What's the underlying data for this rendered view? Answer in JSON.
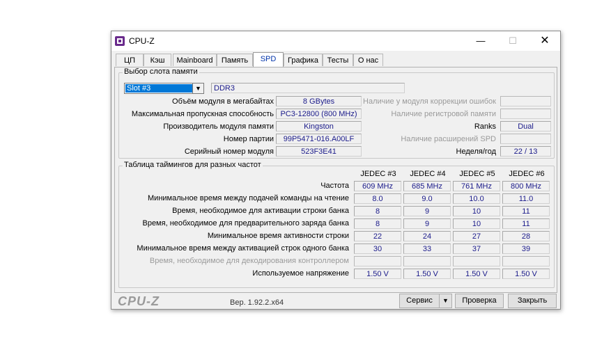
{
  "window": {
    "title": "CPU-Z",
    "minimize_glyph": "—",
    "maximize_glyph": "☐",
    "close_glyph": "✕"
  },
  "tabs": [
    {
      "label": "ЦП"
    },
    {
      "label": "Кэш"
    },
    {
      "label": "Mainboard"
    },
    {
      "label": "Память"
    },
    {
      "label": "SPD",
      "active": true
    },
    {
      "label": "Графика"
    },
    {
      "label": "Тесты"
    },
    {
      "label": "О нас"
    }
  ],
  "slot": {
    "legend": "Выбор слота памяти",
    "selected": "Slot #3",
    "type": "DDR3",
    "module_size_label": "Объём модуля в мегабайтах",
    "module_size": "8 GBytes",
    "max_bandwidth_label": "Максимальная пропускная способность",
    "max_bandwidth": "PC3-12800 (800 MHz)",
    "manufacturer_label": "Производитель модуля памяти",
    "manufacturer": "Kingston",
    "part_number_label": "Номер партии",
    "part_number": "99P5471-016.A00LF",
    "serial_label": "Серийный номер модуля",
    "serial": "523F3E41",
    "ecc_label": "Наличие у модуля коррекции ошибок",
    "registered_label": "Наличие регистровой памяти",
    "ranks_label": "Ranks",
    "ranks": "Dual",
    "spd_ext_label": "Наличие расширений SPD",
    "week_year_label": "Неделя/год",
    "week_year": "22 / 13"
  },
  "timings": {
    "legend": "Таблица таймингов для разных частот",
    "columns": [
      "JEDEC #3",
      "JEDEC #4",
      "JEDEC #5",
      "JEDEC #6"
    ],
    "rows": [
      {
        "label": "Частота",
        "values": [
          "609 MHz",
          "685 MHz",
          "761 MHz",
          "800 MHz"
        ]
      },
      {
        "label": "Минимальное время между подачей команды на чтение",
        "values": [
          "8.0",
          "9.0",
          "10.0",
          "11.0"
        ]
      },
      {
        "label": "Время, необходимое для активации строки банка",
        "values": [
          "8",
          "9",
          "10",
          "11"
        ]
      },
      {
        "label": "Время, необходимое для предварительного заряда банка",
        "values": [
          "8",
          "9",
          "10",
          "11"
        ]
      },
      {
        "label": "Минимальное время активности строки",
        "values": [
          "22",
          "24",
          "27",
          "28"
        ]
      },
      {
        "label": "Минимальное время между активацией строк одного банка",
        "values": [
          "30",
          "33",
          "37",
          "39"
        ]
      },
      {
        "label": "Время, необходимое для декодирования контроллером",
        "values": [
          "",
          "",
          "",
          ""
        ],
        "disabled": true
      },
      {
        "label": "Используемое напряжение",
        "values": [
          "1.50 V",
          "1.50 V",
          "1.50 V",
          "1.50 V"
        ]
      }
    ]
  },
  "footer": {
    "logo": "CPU-Z",
    "version": "Вер. 1.92.2.x64",
    "service_button": "Сервис",
    "service_arrow": "▼",
    "validate_button": "Проверка",
    "close_button": "Закрыть"
  }
}
